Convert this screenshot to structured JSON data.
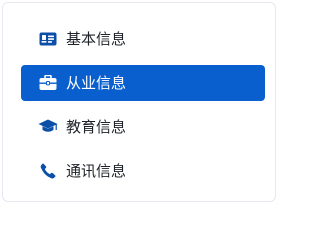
{
  "menu": {
    "items": [
      {
        "label": "基本信息",
        "icon": "id-card-icon"
      },
      {
        "label": "从业信息",
        "icon": "briefcase-icon",
        "active": true
      },
      {
        "label": "教育信息",
        "icon": "graduation-cap-icon"
      },
      {
        "label": "通讯信息",
        "icon": "phone-icon"
      }
    ]
  },
  "colors": {
    "accent": "#0a5fcf",
    "icon": "#0b4fa8",
    "text": "#1f2329"
  }
}
